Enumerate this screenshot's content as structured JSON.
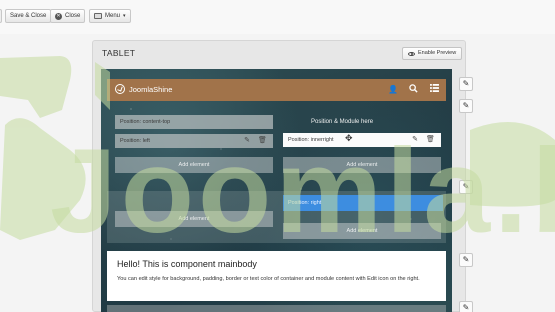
{
  "toolbar": {
    "save_close_label": "Save & Close",
    "close_label": "Close",
    "menu_label": "Menu"
  },
  "panel": {
    "title": "TABLET",
    "enable_preview_label": "Enable Preview"
  },
  "navbar": {
    "brand": "JoomlaShine"
  },
  "positions": {
    "content_top": "Position: content-top",
    "left": "Position: left",
    "innerright": "Position: innerright",
    "module_here": "Position & Module here",
    "right": "Position: right"
  },
  "add_element_label": "Add element",
  "mainbody": {
    "title": "Hello! This is component mainbody",
    "description": "You can edit style for background, padding, border or text color of container and module content with Edit icon on the right."
  },
  "watermark": "Joomla.b",
  "colors": {
    "navbar": "#a1734a",
    "position_highlight": "#3d8de0",
    "watermark": "#cde2ad"
  },
  "icons": [
    "save-icon",
    "close-icon",
    "menu-icon",
    "eye-icon",
    "joomlashine-logo-icon",
    "user-icon",
    "search-icon",
    "list-icon",
    "edit-icon",
    "trash-icon",
    "move-cursor-icon"
  ]
}
